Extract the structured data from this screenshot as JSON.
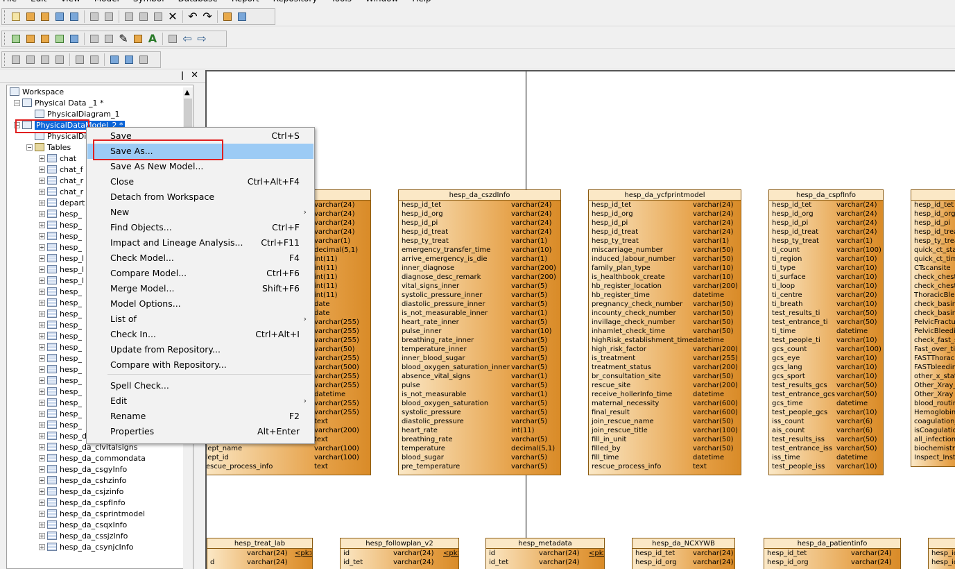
{
  "menubar": [
    "File",
    "Edit",
    "View",
    "Model",
    "Symbol",
    "Database",
    "Report",
    "Repository",
    "Tools",
    "Window",
    "Help"
  ],
  "tree": {
    "workspace": "Workspace",
    "model1": "Physical Data _1 *",
    "diagram1": "PhysicalDiagram_1",
    "model2": "PhysicalDataModel_2 *",
    "diagram2": "PhysicalDi",
    "tables_folder": "Tables",
    "tables_partial": [
      "chat",
      "chat_f",
      "chat_r",
      "chat_r",
      "depart",
      "hesp_",
      "hesp_",
      "hesp_",
      "hesp_",
      "hesp_l",
      "hesp_l",
      "hesp_l",
      "hesp_",
      "hesp_",
      "hesp_",
      "hesp_",
      "hesp_",
      "hesp_",
      "hesp_",
      "hesp_",
      "hesp_",
      "hesp_",
      "hesp_",
      "hesp_",
      "hesp_"
    ],
    "tables_full": [
      "hesp_da_clinicrescue",
      "hesp_da_clvitalsigns",
      "hesp_da_commondata",
      "hesp_da_csgyInfo",
      "hesp_da_cshzinfo",
      "hesp_da_csjzinfo",
      "hesp_da_cspfInfo",
      "hesp_da_csprintmodel",
      "hesp_da_csqxInfo",
      "hesp_da_cssjzInfo",
      "hesp_da_csynjcInfo"
    ]
  },
  "context_menu": [
    {
      "label": "Save",
      "shortcut": "Ctrl+S"
    },
    {
      "label": "Save As...",
      "shortcut": "",
      "highlighted": true
    },
    {
      "label": "Save As New Model...",
      "shortcut": ""
    },
    {
      "label": "Close",
      "shortcut": "Ctrl+Alt+F4"
    },
    {
      "label": "Detach from Workspace",
      "shortcut": ""
    },
    {
      "label": "New",
      "shortcut": "",
      "submenu": true
    },
    {
      "label": "Find Objects...",
      "shortcut": "Ctrl+F"
    },
    {
      "label": "Impact and Lineage Analysis...",
      "shortcut": "Ctrl+F11"
    },
    {
      "label": "Check Model...",
      "shortcut": "F4"
    },
    {
      "label": "Compare Model...",
      "shortcut": "Ctrl+F6"
    },
    {
      "label": "Merge Model...",
      "shortcut": "Shift+F6"
    },
    {
      "label": "Model Options...",
      "shortcut": ""
    },
    {
      "label": "List of",
      "shortcut": "",
      "submenu": true
    },
    {
      "label": "Check In...",
      "shortcut": "Ctrl+Alt+I"
    },
    {
      "label": "Update from Repository...",
      "shortcut": ""
    },
    {
      "label": "Compare with Repository...",
      "shortcut": ""
    },
    {
      "label": "Spell Check...",
      "shortcut": ""
    },
    {
      "label": "Edit",
      "shortcut": "",
      "submenu": true
    },
    {
      "label": "Rename",
      "shortcut": "F2"
    },
    {
      "label": "Properties",
      "shortcut": "Alt+Enter"
    }
  ],
  "entities": [
    {
      "name": "",
      "rows": [
        [
          "",
          "varchar(24)"
        ],
        [
          "",
          "varchar(24)"
        ],
        [
          "",
          "varchar(24)"
        ],
        [
          "",
          "varchar(24)"
        ],
        [
          "",
          "varchar(1)"
        ],
        [
          "",
          "decimal(5,1)"
        ],
        [
          "",
          "int(11)"
        ],
        [
          "",
          "int(11)"
        ],
        [
          "",
          "int(11)"
        ],
        [
          "",
          "int(11)"
        ],
        [
          "",
          "int(11)"
        ],
        [
          "",
          "date"
        ],
        [
          "",
          "date"
        ],
        [
          "",
          "varchar(255)"
        ],
        [
          "",
          "varchar(255)"
        ],
        [
          "",
          "varchar(255)"
        ],
        [
          "",
          "varchar(50)"
        ],
        [
          "",
          "varchar(255)"
        ],
        [
          "",
          "varchar(500)"
        ],
        [
          "",
          "varchar(255)"
        ],
        [
          "",
          "varchar(255)"
        ],
        [
          "",
          "datetime"
        ],
        [
          "",
          "varchar(255)"
        ],
        [
          "",
          "varchar(255)"
        ],
        [
          "",
          "text"
        ],
        [
          "",
          "varchar(200)"
        ],
        [
          "",
          "text"
        ],
        [
          "dept_name",
          "varchar(100)"
        ],
        [
          "dept_id",
          "varchar(100)"
        ],
        [
          "rescue_process_info",
          "text"
        ]
      ]
    },
    {
      "name": "hesp_da_cszdInfo",
      "rows": [
        [
          "hesp_id_tet",
          "varchar(24)"
        ],
        [
          "hesp_id_org",
          "varchar(24)"
        ],
        [
          "hesp_id_pi",
          "varchar(24)"
        ],
        [
          "hesp_id_treat",
          "varchar(24)"
        ],
        [
          "hesp_ty_treat",
          "varchar(1)"
        ],
        [
          "emergency_transfer_time",
          "varchar(10)"
        ],
        [
          "arrive_emergency_is_die",
          "varchar(1)"
        ],
        [
          "inner_diagnose",
          "varchar(200)"
        ],
        [
          "diagnose_desc_remark",
          "varchar(200)"
        ],
        [
          "vital_signs_inner",
          "varchar(5)"
        ],
        [
          "systolic_pressure_inner",
          "varchar(5)"
        ],
        [
          "diastolic_pressure_inner",
          "varchar(5)"
        ],
        [
          "is_not_measurable_inner",
          "varchar(1)"
        ],
        [
          "heart_rate_inner",
          "varchar(5)"
        ],
        [
          "pulse_inner",
          "varchar(10)"
        ],
        [
          "breathing_rate_inner",
          "varchar(5)"
        ],
        [
          "temperature_inner",
          "varchar(5)"
        ],
        [
          "inner_blood_sugar",
          "varchar(5)"
        ],
        [
          "blood_oxygen_saturation_inner",
          "varchar(5)"
        ],
        [
          "absence_vital_signs",
          "varchar(1)"
        ],
        [
          "pulse",
          "varchar(5)"
        ],
        [
          "is_not_measurable",
          "varchar(1)"
        ],
        [
          "blood_oxygen_saturation",
          "varchar(5)"
        ],
        [
          "systolic_pressure",
          "varchar(5)"
        ],
        [
          "diastolic_pressure",
          "varchar(5)"
        ],
        [
          "heart_rate",
          "int(11)"
        ],
        [
          "breathing_rate",
          "varchar(5)"
        ],
        [
          "temperature",
          "decimal(5,1)"
        ],
        [
          "blood_sugar",
          "varchar(5)"
        ],
        [
          "pre_temperature",
          "varchar(5)"
        ]
      ]
    },
    {
      "name": "hesp_da_ycfprintmodel",
      "rows": [
        [
          "hesp_id_tet",
          "varchar(24)"
        ],
        [
          "hesp_id_org",
          "varchar(24)"
        ],
        [
          "hesp_id_pi",
          "varchar(24)"
        ],
        [
          "hesp_id_treat",
          "varchar(24)"
        ],
        [
          "hesp_ty_treat",
          "varchar(1)"
        ],
        [
          "miscarriage_number",
          "varchar(50)"
        ],
        [
          "induced_labour_number",
          "varchar(50)"
        ],
        [
          "family_plan_type",
          "varchar(10)"
        ],
        [
          "is_healthbook_create",
          "varchar(10)"
        ],
        [
          "hb_register_location",
          "varchar(200)"
        ],
        [
          "hb_register_time",
          "datetime"
        ],
        [
          "pregnancy_check_number",
          "varchar(50)"
        ],
        [
          "incounty_check_number",
          "varchar(50)"
        ],
        [
          "invillage_check_number",
          "varchar(50)"
        ],
        [
          "inhamlet_check_time",
          "varchar(50)"
        ],
        [
          "highRisk_establishment_time",
          "datetime"
        ],
        [
          "high_risk_factor",
          "varchar(200)"
        ],
        [
          "is_treatment",
          "varchar(255)"
        ],
        [
          "treatment_status",
          "varchar(200)"
        ],
        [
          "br_consultation_site",
          "varchar(50)"
        ],
        [
          "rescue_site",
          "varchar(200)"
        ],
        [
          "receive_hollerInfo_time",
          "datetime"
        ],
        [
          "maternal_necessity",
          "varchar(600)"
        ],
        [
          "final_result",
          "varchar(600)"
        ],
        [
          "join_rescue_name",
          "varchar(50)"
        ],
        [
          "join_rescue_title",
          "varchar(100)"
        ],
        [
          "fill_in_unit",
          "varchar(50)"
        ],
        [
          "filled_by",
          "varchar(50)"
        ],
        [
          "fill_time",
          "datetime"
        ],
        [
          "rescue_process_info",
          "text"
        ]
      ]
    },
    {
      "name": "hesp_da_cspfInfo",
      "rows": [
        [
          "hesp_id_tet",
          "varchar(24)"
        ],
        [
          "hesp_id_org",
          "varchar(24)"
        ],
        [
          "hesp_id_pi",
          "varchar(24)"
        ],
        [
          "hesp_id_treat",
          "varchar(24)"
        ],
        [
          "hesp_ty_treat",
          "varchar(1)"
        ],
        [
          "ti_count",
          "varchar(100)"
        ],
        [
          "ti_region",
          "varchar(10)"
        ],
        [
          "ti_type",
          "varchar(10)"
        ],
        [
          "ti_surface",
          "varchar(10)"
        ],
        [
          "ti_loop",
          "varchar(10)"
        ],
        [
          "ti_centre",
          "varchar(20)"
        ],
        [
          "ti_breath",
          "varchar(10)"
        ],
        [
          "test_results_ti",
          "varchar(50)"
        ],
        [
          "test_entrance_ti",
          "varchar(50)"
        ],
        [
          "ti_time",
          "datetime"
        ],
        [
          "test_people_ti",
          "varchar(10)"
        ],
        [
          "gcs_count",
          "varchar(100)"
        ],
        [
          "gcs_eye",
          "varchar(10)"
        ],
        [
          "gcs_lang",
          "varchar(10)"
        ],
        [
          "gcs_sport",
          "varchar(10)"
        ],
        [
          "test_results_gcs",
          "varchar(50)"
        ],
        [
          "test_entrance_gcs",
          "varchar(50)"
        ],
        [
          "gcs_time",
          "datetime"
        ],
        [
          "test_people_gcs",
          "varchar(10)"
        ],
        [
          "iss_count",
          "varchar(6)"
        ],
        [
          "ais_count",
          "varchar(6)"
        ],
        [
          "test_results_iss",
          "varchar(50)"
        ],
        [
          "test_entrance_iss",
          "varchar(50)"
        ],
        [
          "iss_time",
          "datetime"
        ],
        [
          "test_people_iss",
          "varchar(10)"
        ]
      ]
    },
    {
      "name": "",
      "rows": [
        [
          "hesp_id_tet",
          ""
        ],
        [
          "hesp_id_org",
          ""
        ],
        [
          "hesp_id_pi",
          ""
        ],
        [
          "hesp_id_trea",
          ""
        ],
        [
          "hesp_ty_trea",
          ""
        ],
        [
          "quick_ct_stat",
          ""
        ],
        [
          "quick_ct_time",
          ""
        ],
        [
          "CTscansite",
          ""
        ],
        [
          "check_chest_",
          ""
        ],
        [
          "check_chest_",
          ""
        ],
        [
          "ThoracicBlee",
          ""
        ],
        [
          "check_basin_",
          ""
        ],
        [
          "check_basin_",
          ""
        ],
        [
          "PelvicFractur",
          ""
        ],
        [
          "PelvicBleedi",
          ""
        ],
        [
          "check_fast_st",
          ""
        ],
        [
          "Fast_over_tir",
          ""
        ],
        [
          "FASTThoraci",
          ""
        ],
        [
          "FASTbleedin",
          ""
        ],
        [
          "other_x_statu",
          ""
        ],
        [
          "Other_Xray_t",
          ""
        ],
        [
          "Other_Xray",
          ""
        ],
        [
          "blood_routin",
          ""
        ],
        [
          "Hemoglobin",
          ""
        ],
        [
          "coagulation_",
          ""
        ],
        [
          "isCoagulatio",
          ""
        ],
        [
          "all_infection",
          ""
        ],
        [
          "biochemistry",
          ""
        ],
        [
          "Inspect_Instru",
          ""
        ]
      ]
    },
    {
      "name": "hesp_treat_lab",
      "rows": [
        [
          "",
          "varchar(24)",
          "<pk>"
        ],
        [
          "d",
          "varchar(24)",
          ""
        ]
      ]
    },
    {
      "name": "hesp_followplan_v2",
      "rows": [
        [
          "id",
          "varchar(24)",
          "<pk>"
        ],
        [
          "id_tet",
          "varchar(24)",
          ""
        ]
      ]
    },
    {
      "name": "hesp_metadata",
      "rows": [
        [
          "id",
          "varchar(24)",
          "<pk>"
        ],
        [
          "id_tet",
          "varchar(24)",
          ""
        ]
      ]
    },
    {
      "name": "hesp_da_NCXYWB",
      "rows": [
        [
          "hesp_id_tet",
          "varchar(24)"
        ],
        [
          "hesp_id_org",
          "varchar(24)"
        ]
      ]
    },
    {
      "name": "hesp_da_patientinfo",
      "rows": [
        [
          "hesp_id_tet",
          "varchar(24)"
        ],
        [
          "hesp_id_org",
          "varchar(24)"
        ]
      ]
    },
    {
      "name": "",
      "rows": [
        [
          "hesp_id",
          ""
        ],
        [
          "hesp_id",
          ""
        ]
      ]
    }
  ]
}
